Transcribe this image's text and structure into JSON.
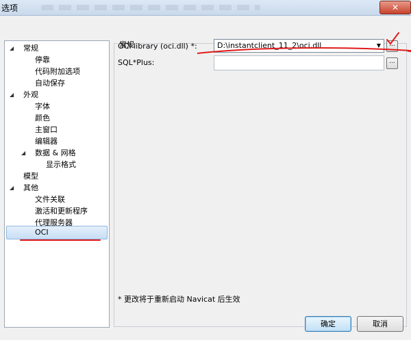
{
  "window": {
    "title": "选项",
    "close_label": "✕"
  },
  "tree": {
    "items": [
      {
        "label": "常规",
        "arrow": "◢"
      },
      {
        "label": "停靠"
      },
      {
        "label": "代码附加选项"
      },
      {
        "label": "自动保存"
      },
      {
        "label": "外观",
        "arrow": "◢"
      },
      {
        "label": "字体"
      },
      {
        "label": "颜色"
      },
      {
        "label": "主窗口"
      },
      {
        "label": "编辑器"
      },
      {
        "label": "数据 & 网格",
        "arrow": "◢"
      },
      {
        "label": "显示格式"
      },
      {
        "label": "模型"
      },
      {
        "label": "其他",
        "arrow": "◢"
      },
      {
        "label": "文件关联"
      },
      {
        "label": "激活和更新程序"
      },
      {
        "label": "代理服务器"
      },
      {
        "label": "OCI"
      }
    ],
    "selected": "OCI"
  },
  "settings": {
    "group_title": "常规",
    "oci_label": "OCI library (oci.dll) *:",
    "oci_value": "D:\\instantclient_11_2\\oci.dll",
    "sqlplus_label": "SQL*Plus:",
    "sqlplus_value": "",
    "browse_label": "...",
    "combo_arrow": "▼"
  },
  "note": "* 更改将于重新启动 Navicat 后生效",
  "buttons": {
    "ok": "确定",
    "cancel": "取消"
  },
  "colors": {
    "annotation": "#e01a1a",
    "selection": "#c7def5"
  }
}
